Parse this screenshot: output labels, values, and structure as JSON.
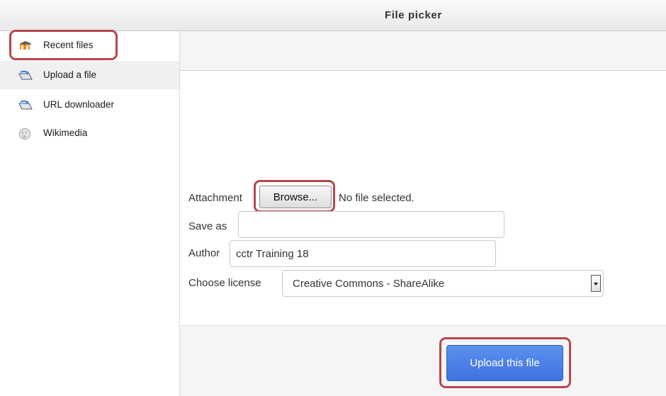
{
  "window": {
    "title": "File picker"
  },
  "sidebar": {
    "items": [
      {
        "label": "Recent files",
        "icon": "moodle-icon"
      },
      {
        "label": "Upload a file",
        "icon": "upload-icon"
      },
      {
        "label": "URL downloader",
        "icon": "url-download-icon"
      },
      {
        "label": "Wikimedia",
        "icon": "wikimedia-globe-icon"
      }
    ]
  },
  "form": {
    "attachment_label": "Attachment",
    "browse_label": "Browse...",
    "file_status": "No file selected.",
    "save_as_label": "Save as",
    "save_as_value": "",
    "author_label": "Author",
    "author_value": "cctr Training 18",
    "license_label": "Choose license",
    "license_value": "Creative Commons - ShareAlike"
  },
  "footer": {
    "upload_label": "Upload this file"
  },
  "colors": {
    "highlight": "#b5474c",
    "primary_button": "#4a7fe6",
    "moodle_orange": "#f28b1a"
  }
}
